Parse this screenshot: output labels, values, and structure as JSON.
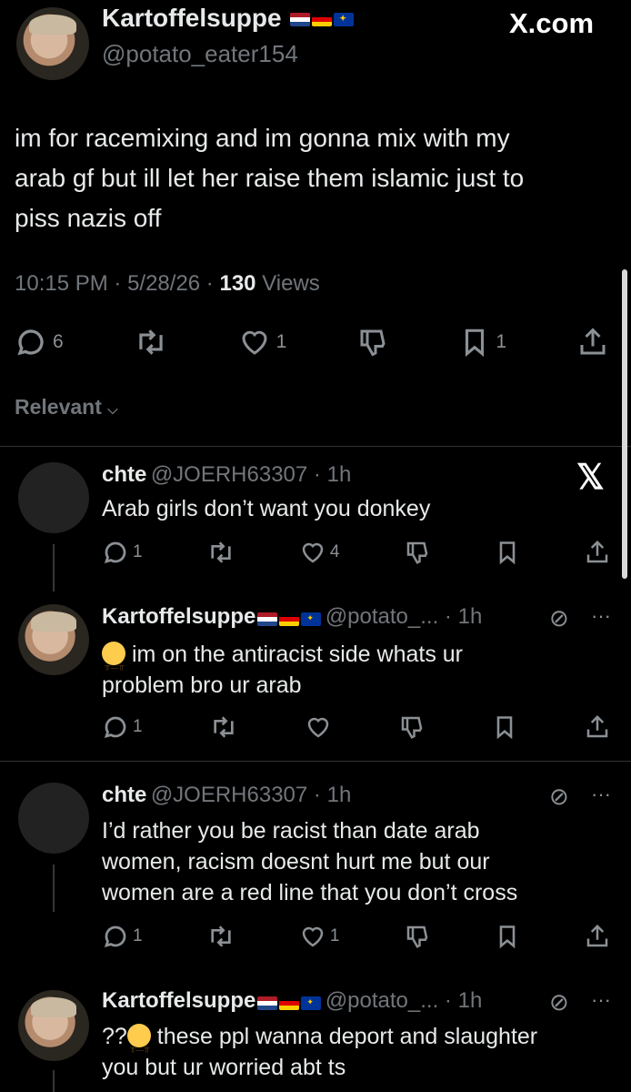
{
  "main_post": {
    "author_name": "Kartoffelsuppe",
    "author_handle": "@potato_eater154",
    "site_label": "X.com",
    "text_line1": "im for racemixing and im gonna mix with my",
    "text_line2": "arab gf but ill let her raise  them islamic just to",
    "text_line3": "piss nazis off",
    "time": "10:15 PM",
    "date": "5/28/26",
    "views_count": "130",
    "views_label": "Views",
    "reply_count": "6",
    "like_count": "1",
    "bookmark_count": "1"
  },
  "sort_label": "Relevant",
  "replies": [
    {
      "name": "chte",
      "handle": "@JOERH63307",
      "age": "1h",
      "text_lines": [
        "Arab girls don’t want you donkey"
      ],
      "reply_count": "1",
      "like_count": "4"
    },
    {
      "name": "Kartoffelsuppe",
      "handle": "@potato_...",
      "age": "1h",
      "text_lines": [
        "im on the antiracist side whats ur",
        "problem bro ur arab"
      ],
      "reply_count": "1"
    },
    {
      "name": "chte",
      "handle": "@JOERH63307",
      "age": "1h",
      "text_lines": [
        "I’d rather you be racist than date arab",
        "women, racism doesnt hurt me but our",
        "women are a red line that you don’t cross"
      ],
      "reply_count": "1",
      "like_count": "1"
    },
    {
      "name": "Kartoffelsuppe",
      "handle": "@potato_...",
      "age": "1h",
      "text_prefix": "??",
      "text_lines": [
        "these ppl wanna deport and slaughter",
        "you but ur worried abt ts"
      ]
    }
  ],
  "icons": {
    "reply": "comment-bubble-icon",
    "retweet": "retweet-icon",
    "like": "heart-icon",
    "dislike": "dislike-icon",
    "bookmark": "bookmark-icon",
    "share": "share-icon",
    "more": "more-dots-icon",
    "grok": "grok-icon",
    "x_logo": "x-logo-icon"
  },
  "colors": {
    "background": "#000000",
    "text": "#e7e9ea",
    "muted": "#71767b"
  }
}
